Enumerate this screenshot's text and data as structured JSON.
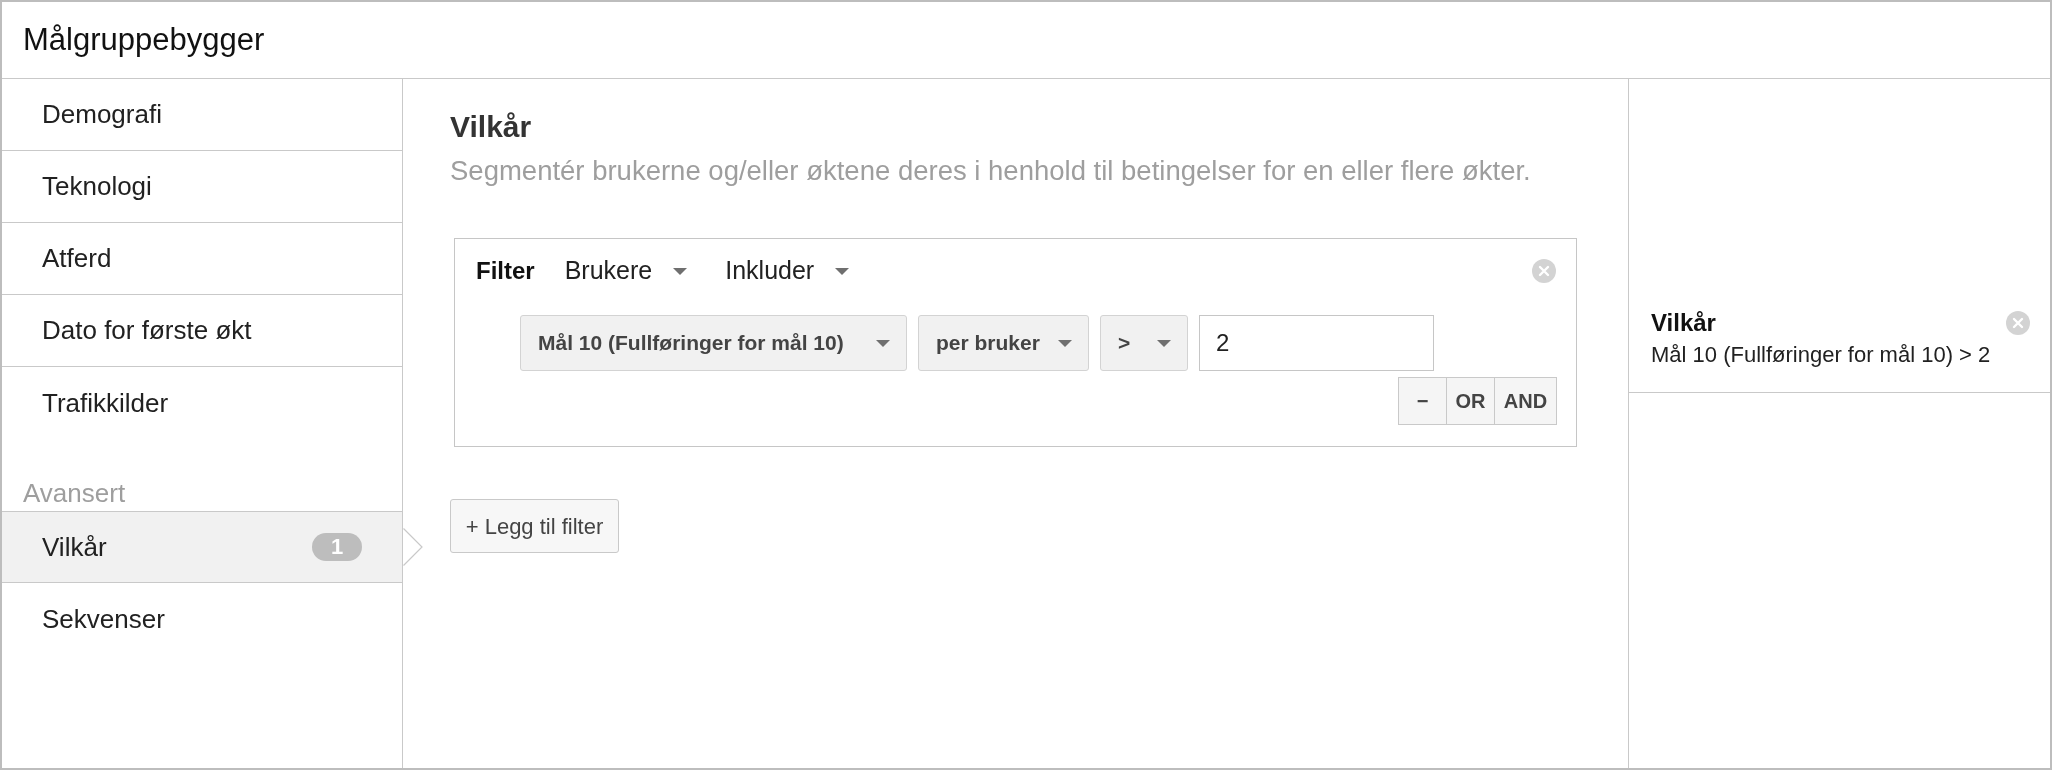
{
  "window": {
    "title": "Målgruppebygger"
  },
  "sidebar": {
    "groups": [
      {
        "items": [
          {
            "label": "Demografi",
            "selected": false
          },
          {
            "label": "Teknologi",
            "selected": false
          },
          {
            "label": "Atferd",
            "selected": false
          },
          {
            "label": "Dato for første økt",
            "selected": false
          },
          {
            "label": "Trafikkilder",
            "selected": false
          }
        ]
      },
      {
        "heading": "Avansert",
        "items": [
          {
            "label": "Vilkår",
            "selected": true,
            "badge": "1"
          },
          {
            "label": "Sekvenser",
            "selected": false
          }
        ]
      }
    ]
  },
  "main": {
    "title": "Vilkår",
    "description": "Segmentér brukerne og/eller øktene deres i henhold til betingelser for en eller flere økter.",
    "filters": [
      {
        "label": "Filter",
        "selectors": [
          "Brukere",
          "Inkluder"
        ],
        "conditions": [
          {
            "dropdowns": [
              "Mål 10 (Fullføringer for mål 10)",
              "per bruker",
              ">"
            ],
            "value": "2"
          }
        ],
        "actions": [
          "−",
          "OR",
          "AND"
        ]
      }
    ],
    "add_filter_button": "+ Legg til filter"
  },
  "summary": {
    "items": [
      {
        "title": "Vilkår",
        "description": "Mål 10 (Fullføringer for mål 10) > 2"
      }
    ]
  }
}
